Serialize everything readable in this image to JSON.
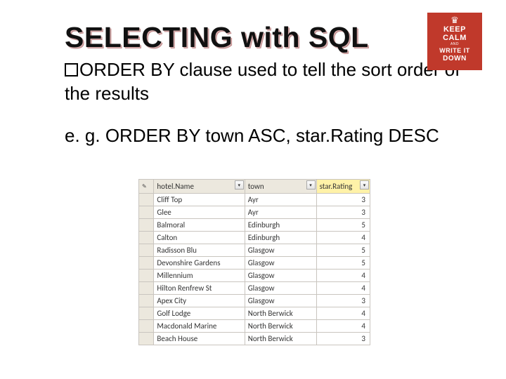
{
  "badge": {
    "l1": "KEEP",
    "l2": "CALM",
    "l3": "AND",
    "l4": "WRITE IT",
    "l5": "DOWN"
  },
  "title": "SELECTING with SQL",
  "bullet_text": "ORDER BY clause used to tell the sort order of the results",
  "example_text": "e. g. ORDER BY town ASC, star.Rating DESC",
  "table": {
    "headers": {
      "name": "hotel.Name",
      "town": "town",
      "star": "star.Rating"
    }
  },
  "chart_data": {
    "type": "table",
    "columns": [
      "hotel.Name",
      "town",
      "star.Rating"
    ],
    "sorted_by": [
      {
        "column": "town",
        "direction": "ASC"
      },
      {
        "column": "star.Rating",
        "direction": "DESC"
      }
    ],
    "rows": [
      {
        "hotelName": "Cliff Top",
        "town": "Ayr",
        "starRating": 3
      },
      {
        "hotelName": "Glee",
        "town": "Ayr",
        "starRating": 3
      },
      {
        "hotelName": "Balmoral",
        "town": "Edinburgh",
        "starRating": 5
      },
      {
        "hotelName": "Calton",
        "town": "Edinburgh",
        "starRating": 4
      },
      {
        "hotelName": "Radisson Blu",
        "town": "Glasgow",
        "starRating": 5
      },
      {
        "hotelName": "Devonshire Gardens",
        "town": "Glasgow",
        "starRating": 5
      },
      {
        "hotelName": "Millennium",
        "town": "Glasgow",
        "starRating": 4
      },
      {
        "hotelName": "Hilton Renfrew St",
        "town": "Glasgow",
        "starRating": 4
      },
      {
        "hotelName": "Apex City",
        "town": "Glasgow",
        "starRating": 3
      },
      {
        "hotelName": "Golf Lodge",
        "town": "North Berwick",
        "starRating": 4
      },
      {
        "hotelName": "Macdonald Marine",
        "town": "North Berwick",
        "starRating": 4
      },
      {
        "hotelName": "Beach House",
        "town": "North Berwick",
        "starRating": 3
      }
    ]
  }
}
